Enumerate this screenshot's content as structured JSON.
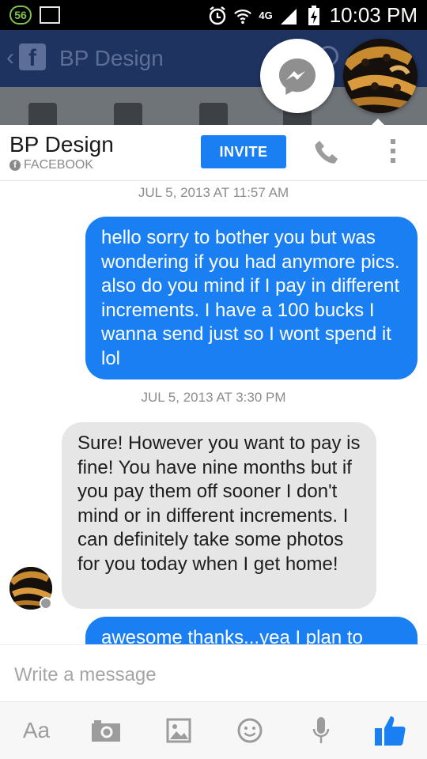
{
  "status_bar": {
    "notification_count": "56",
    "network": "4G",
    "time": "10:03 PM"
  },
  "background_app": {
    "title": "BP Design"
  },
  "header": {
    "name": "BP Design",
    "source": "FACEBOOK",
    "invite_label": "INVITE"
  },
  "messages": [
    {
      "type": "timestamp",
      "text": "JUL 5, 2013 AT 11:57 AM"
    },
    {
      "type": "outgoing",
      "text": "hello sorry to bother you but was wondering if you had anymore pics. also do you mind if I pay in different increments. I have a 100 bucks I wanna send just so I wont spend it lol"
    },
    {
      "type": "timestamp",
      "text": "JUL 5, 2013 AT 3:30 PM"
    },
    {
      "type": "incoming",
      "text": "Sure! However you want to pay is fine! You have nine months but if you pay them off sooner I don't mind or in different increments. I can definitely take some photos for you today when I get home!"
    },
    {
      "type": "outgoing",
      "text": "awesome thanks...yea I plan to"
    }
  ],
  "composer": {
    "placeholder": "Write a message"
  },
  "toolbar": {
    "text_label": "Aa",
    "icons": [
      "text-format-icon",
      "camera-icon",
      "gallery-icon",
      "emoji-icon",
      "microphone-icon",
      "like-icon"
    ]
  },
  "colors": {
    "accent": "#1a7ff2",
    "incoming_bubble": "#e6e6e6",
    "fb_bar": "#1f3360"
  }
}
